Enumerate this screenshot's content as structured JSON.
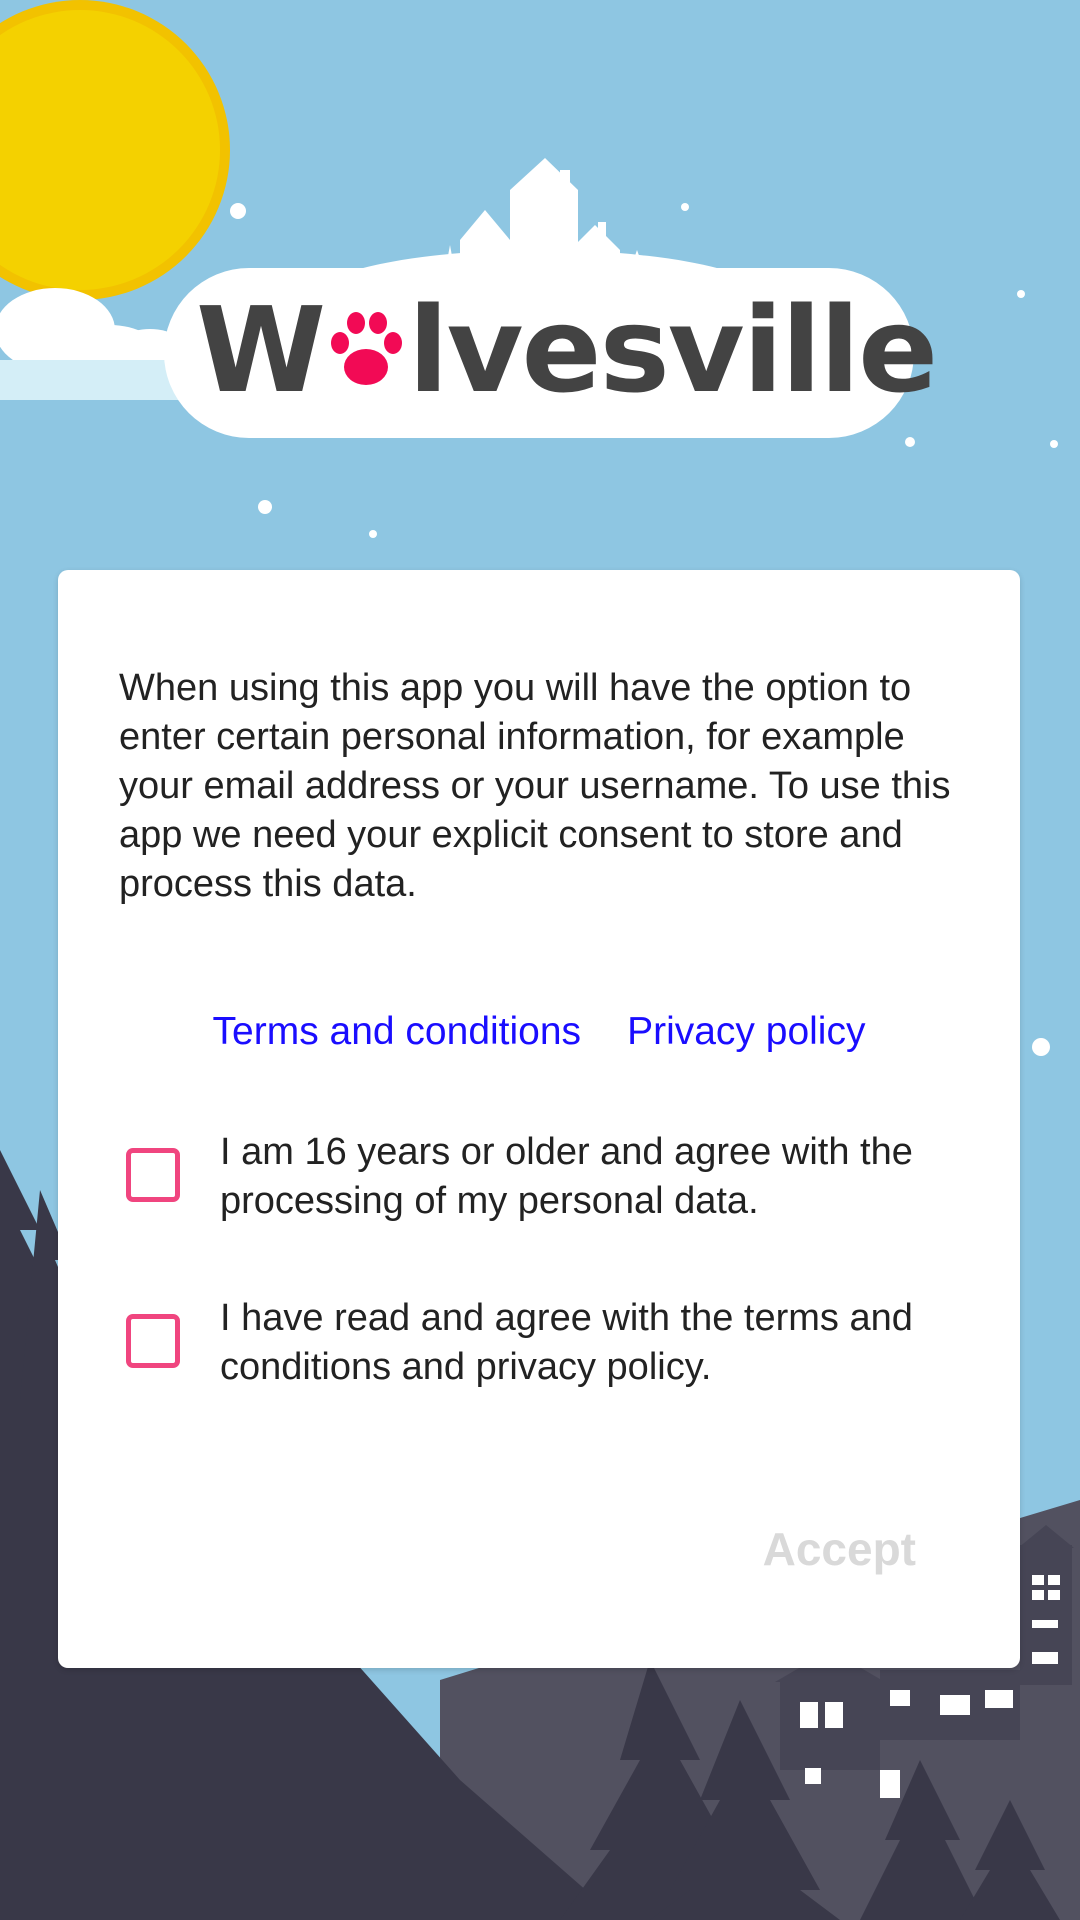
{
  "app": {
    "logo_text_before": "W",
    "logo_text_after": "lvesville",
    "logo_icon": "paw-icon"
  },
  "consent": {
    "intro": "When using this app you will have the option to enter certain personal information, for example your email address or your username. To use this app we need your explicit consent to store and process this data.",
    "links": {
      "terms_label": "Terms and conditions",
      "privacy_label": "Privacy policy"
    },
    "checkboxes": [
      {
        "label": "I am 16 years or older and agree with the processing of my personal data.",
        "checked": false
      },
      {
        "label": "I have read and agree with the terms and conditions and privacy policy.",
        "checked": false
      }
    ],
    "accept_label": "Accept",
    "accept_enabled": false
  },
  "colors": {
    "sky": "#8ec6e2",
    "sun": "#f4d100",
    "accent_pink": "#f0457f",
    "link_blue": "#1a0dff",
    "forest_dark": "#3a3a48",
    "disabled_text": "#d9d9d9"
  }
}
